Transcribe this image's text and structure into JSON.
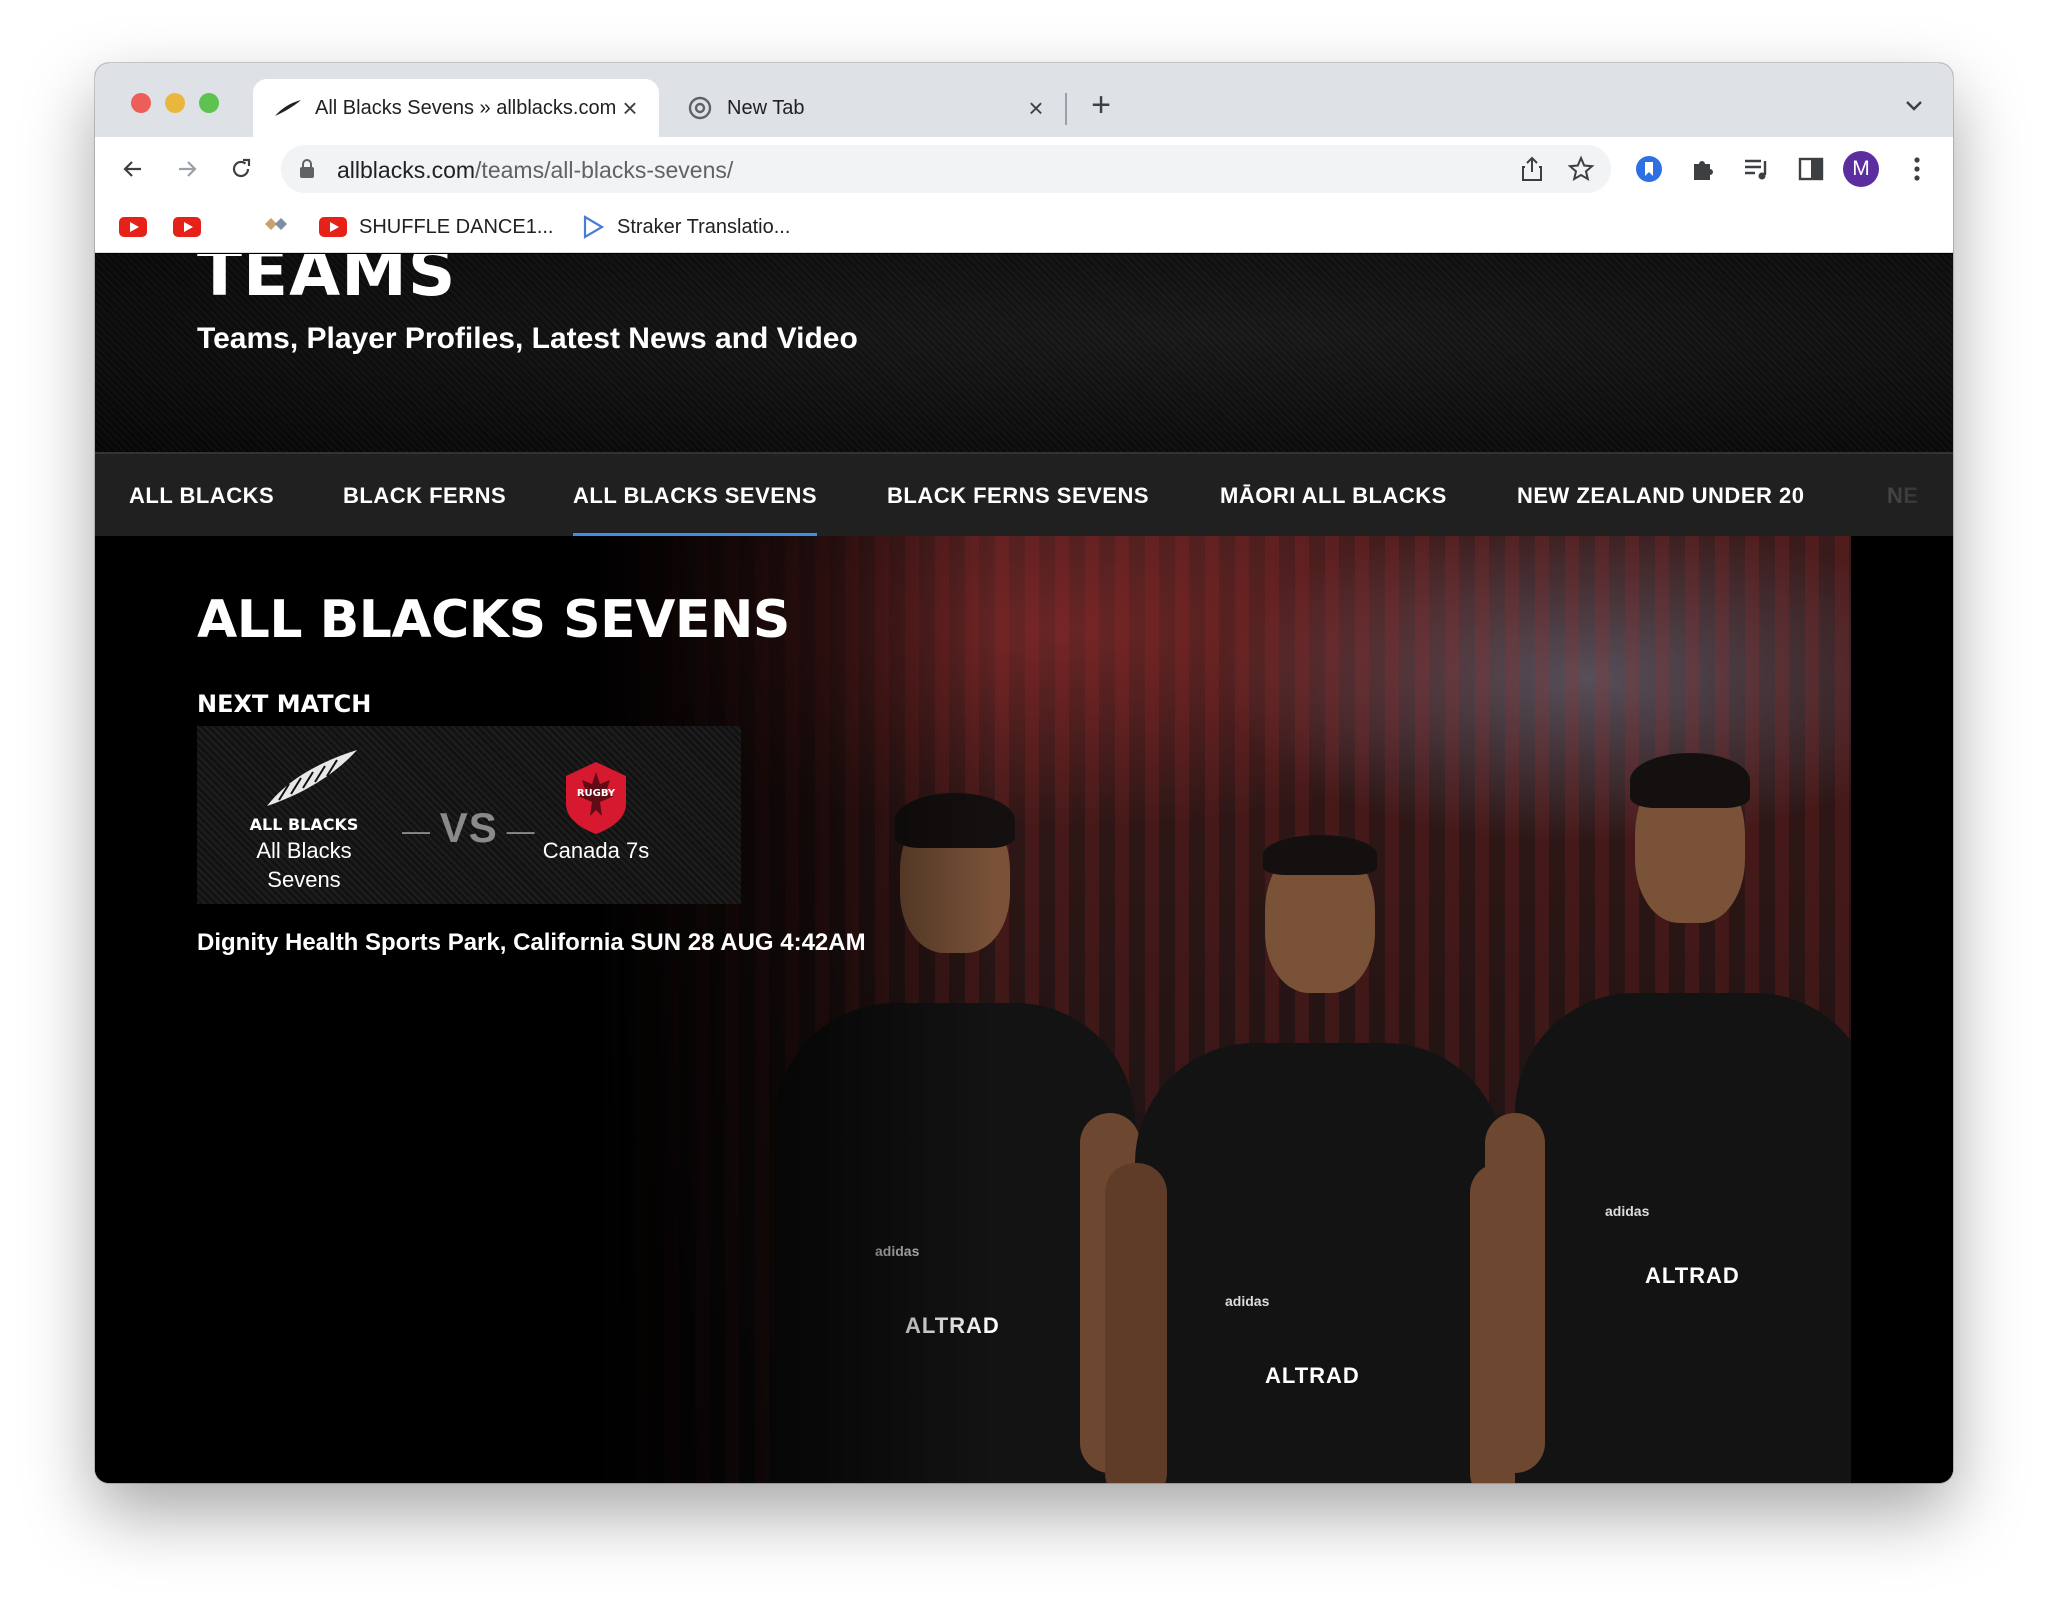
{
  "browser": {
    "tabs": [
      {
        "title": "All Blacks Sevens » allblacks.com",
        "active": true,
        "favicon": "fern-icon"
      },
      {
        "title": "New Tab",
        "active": false,
        "favicon": "chrome-icon"
      }
    ],
    "url_host": "allblacks.com",
    "url_path": "/teams/all-blacks-sevens/",
    "profile_initial": "M",
    "bookmarks": [
      {
        "label": "",
        "icon": "youtube-icon"
      },
      {
        "label": "",
        "icon": "youtube-icon"
      },
      {
        "label": "",
        "icon": "extension-diamond-icon"
      },
      {
        "label": "SHUFFLE DANCE1...",
        "icon": "youtube-icon"
      },
      {
        "label": "Straker Translatio...",
        "icon": "play-outline-icon"
      }
    ]
  },
  "page": {
    "heading": "TEAMS",
    "subheading": "Teams, Player Profiles, Latest News and Video",
    "team_nav": [
      {
        "label": "ALL BLACKS",
        "active": false
      },
      {
        "label": "BLACK FERNS",
        "active": false
      },
      {
        "label": "ALL BLACKS SEVENS",
        "active": true
      },
      {
        "label": "BLACK FERNS SEVENS",
        "active": false
      },
      {
        "label": "MĀORI ALL BLACKS",
        "active": false
      },
      {
        "label": "NEW ZEALAND UNDER 20",
        "active": false
      },
      {
        "label": "NE",
        "active": false
      }
    ],
    "section_title": "ALL BLACKS SEVENS",
    "next_match": {
      "label": "NEXT MATCH",
      "home_logo_text": "ALL BLACKS",
      "home_team": "All Blacks Sevens",
      "vs": "VS",
      "away_logo_text": "RUGBY",
      "away_team": "Canada 7s",
      "venue_time": "Dignity Health Sports Park, California SUN 28 AUG 4:42AM"
    },
    "hero_brand": "ALTRAD",
    "hero_brand_small": "adidas",
    "accent_color": "#3d8fe8"
  }
}
